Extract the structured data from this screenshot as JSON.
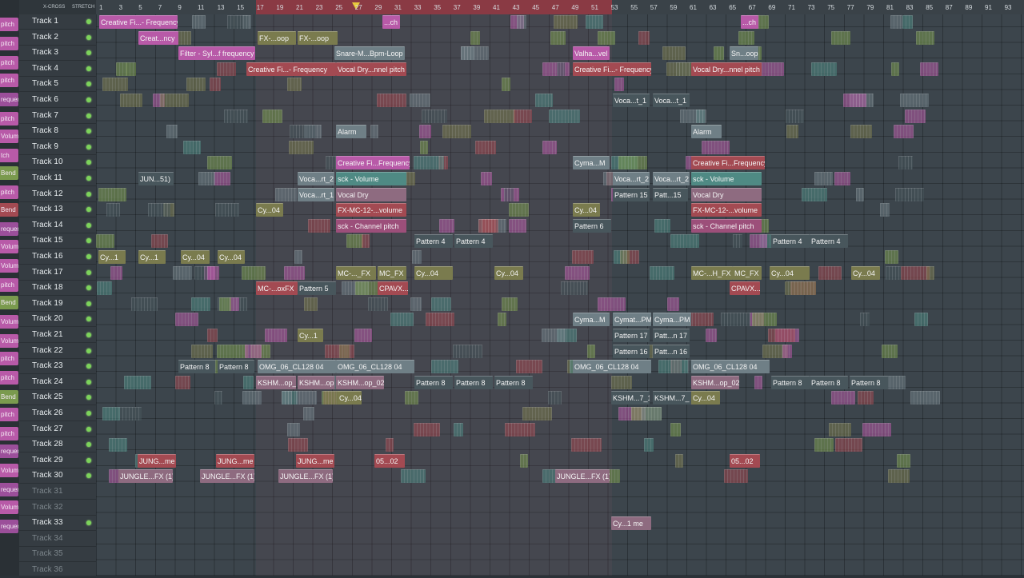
{
  "left_strip": [
    "pitch",
    "pitch",
    "pitch",
    "pitch",
    "requency",
    "pitch",
    "",
    "Volume",
    "tch",
    "Bend",
    "pitch",
    "Bend",
    "requency",
    "Volume",
    "Volume",
    "pitch",
    "Bend",
    "Volume",
    "Volume",
    "pitch",
    "pitch",
    "Bend",
    "pitch",
    "pitch",
    "requency",
    "Volume",
    "requency",
    "Volume",
    "requency"
  ],
  "top_controls": {
    "xcross": "X-CROSS",
    "stretch": "STRETCH"
  },
  "ruler_ticks": [
    "1",
    "3",
    "5",
    "7",
    "9",
    "11",
    "13",
    "15",
    "17",
    "19",
    "21",
    "23",
    "25",
    "27",
    "29",
    "31",
    "33",
    "35",
    "37",
    "39",
    "41",
    "43",
    "45",
    "47",
    "49",
    "51",
    "53",
    "55",
    "57",
    "59",
    "61",
    "63",
    "65",
    "67",
    "69",
    "71",
    "73",
    "75",
    "77",
    "79",
    "81",
    "83",
    "85",
    "87",
    "89",
    "91",
    "93"
  ],
  "tracks": [
    {
      "label": "Track 1",
      "active": true
    },
    {
      "label": "Track 2",
      "active": true
    },
    {
      "label": "Track 3",
      "active": true
    },
    {
      "label": "Track 4",
      "active": true
    },
    {
      "label": "Track 5",
      "active": true
    },
    {
      "label": "Track 6",
      "active": true
    },
    {
      "label": "Track 7",
      "active": true
    },
    {
      "label": "Track 8",
      "active": true
    },
    {
      "label": "Track 9",
      "active": true
    },
    {
      "label": "Track 10",
      "active": true
    },
    {
      "label": "Track 11",
      "active": true
    },
    {
      "label": "Track 12",
      "active": true
    },
    {
      "label": "Track 13",
      "active": true
    },
    {
      "label": "Track 14",
      "active": true
    },
    {
      "label": "Track 15",
      "active": true
    },
    {
      "label": "Track 16",
      "active": true
    },
    {
      "label": "Track 17",
      "active": true
    },
    {
      "label": "Track 18",
      "active": true
    },
    {
      "label": "Track 19",
      "active": true
    },
    {
      "label": "Track 20",
      "active": true
    },
    {
      "label": "Track 21",
      "active": true
    },
    {
      "label": "Track 22",
      "active": true
    },
    {
      "label": "Track 23",
      "active": true
    },
    {
      "label": "Track 24",
      "active": true
    },
    {
      "label": "Track 25",
      "active": true
    },
    {
      "label": "Track 26",
      "active": true
    },
    {
      "label": "Track 27",
      "active": true
    },
    {
      "label": "Track 28",
      "active": true
    },
    {
      "label": "Track 29",
      "active": true
    },
    {
      "label": "Track 30",
      "active": true
    },
    {
      "label": "Track 31",
      "active": false
    },
    {
      "label": "Track 32",
      "active": false
    },
    {
      "label": "Track 33",
      "active": true
    },
    {
      "label": "Track 34",
      "active": false
    },
    {
      "label": "Track 35",
      "active": false
    },
    {
      "label": "Track 36",
      "active": false
    }
  ],
  "clips": [
    {
      "t": 0,
      "label": "Creative Fi...- Frequency",
      "c": "c-pink"
    },
    {
      "t": 0,
      "label": "...ch",
      "c": "c-pink"
    },
    {
      "t": 0,
      "label": "...ch",
      "c": "c-pink"
    },
    {
      "t": 1,
      "label": "Creat...ncy",
      "c": "c-pink"
    },
    {
      "t": 1,
      "label": "FX-...oop",
      "c": "c-olive"
    },
    {
      "t": 1,
      "label": "FX-...oop",
      "c": "c-olive"
    },
    {
      "t": 2,
      "label": "Filter - Syl...f frequency",
      "c": "c-pink"
    },
    {
      "t": 2,
      "label": "Snare-M...Bpm-Loop",
      "c": "c-grey"
    },
    {
      "t": 2,
      "label": "Valha...vel",
      "c": "c-pink"
    },
    {
      "t": 2,
      "label": "Sn...oop",
      "c": "c-grey"
    },
    {
      "t": 3,
      "label": "Creative Fi...- Frequency",
      "c": "c-red"
    },
    {
      "t": 3,
      "label": "Vocal Dry...nnel pitch",
      "c": "c-red"
    },
    {
      "t": 3,
      "label": "Creative Fi...- Frequency",
      "c": "c-red"
    },
    {
      "t": 3,
      "label": "Vocal Dry...nnel pitch",
      "c": "c-red"
    },
    {
      "t": 5,
      "label": "Voca...t_1",
      "c": "c-dark"
    },
    {
      "t": 5,
      "label": "Voca...t_1",
      "c": "c-dark"
    },
    {
      "t": 7,
      "label": "Alarm",
      "c": "c-grey"
    },
    {
      "t": 7,
      "label": "Alarm",
      "c": "c-grey"
    },
    {
      "t": 9,
      "label": "Creative Fi...Frequency",
      "c": "c-pink"
    },
    {
      "t": 9,
      "label": "Cyma...M",
      "c": "c-grey"
    },
    {
      "t": 9,
      "label": "Creative Fi...Frequency",
      "c": "c-red"
    },
    {
      "t": 10,
      "label": "JUN...51)",
      "c": "c-dark"
    },
    {
      "t": 10,
      "label": "Voca...rt_2",
      "c": "c-grey"
    },
    {
      "t": 10,
      "label": "sck - Volume",
      "c": "c-teal"
    },
    {
      "t": 10,
      "label": "Voca...rt_2",
      "c": "c-grey"
    },
    {
      "t": 10,
      "label": "Voca...rt_2",
      "c": "c-grey"
    },
    {
      "t": 10,
      "label": "sck - Volume",
      "c": "c-teal"
    },
    {
      "t": 11,
      "label": "Voca...rt_1",
      "c": "c-grey"
    },
    {
      "t": 11,
      "label": "Vocal Dry",
      "c": "c-mauve"
    },
    {
      "t": 11,
      "label": "Pattern 15",
      "c": "c-dark"
    },
    {
      "t": 11,
      "label": "Patt...15",
      "c": "c-dark"
    },
    {
      "t": 11,
      "label": "Vocal Dry",
      "c": "c-mauve"
    },
    {
      "t": 12,
      "label": "Cy...04",
      "c": "c-olive"
    },
    {
      "t": 12,
      "label": "FX-MC-12-...volume",
      "c": "c-red"
    },
    {
      "t": 12,
      "label": "Cy...04",
      "c": "c-olive"
    },
    {
      "t": 12,
      "label": "FX-MC-12-...volume",
      "c": "c-red"
    },
    {
      "t": 13,
      "label": "sck - Channel pitch",
      "c": "c-rose"
    },
    {
      "t": 13,
      "label": "Pattern 6",
      "c": "c-dark"
    },
    {
      "t": 13,
      "label": "sck - Channel pitch",
      "c": "c-rose"
    },
    {
      "t": 14,
      "label": "Pattern 4",
      "c": "c-dark"
    },
    {
      "t": 14,
      "label": "Pattern 4",
      "c": "c-dark"
    },
    {
      "t": 14,
      "label": "Pattern 4",
      "c": "c-dark"
    },
    {
      "t": 14,
      "label": "Pattern 4",
      "c": "c-dark"
    },
    {
      "t": 15,
      "label": "Cy...1",
      "c": "c-olive"
    },
    {
      "t": 15,
      "label": "Cy...1",
      "c": "c-olive"
    },
    {
      "t": 15,
      "label": "Cy...04",
      "c": "c-olive"
    },
    {
      "t": 15,
      "label": "Cy...04",
      "c": "c-olive"
    },
    {
      "t": 16,
      "label": "MC-..._FX",
      "c": "c-olive"
    },
    {
      "t": 16,
      "label": "MC_FX",
      "c": "c-olive"
    },
    {
      "t": 16,
      "label": "Cy...04",
      "c": "c-olive"
    },
    {
      "t": 16,
      "label": "Cy...04",
      "c": "c-olive"
    },
    {
      "t": 16,
      "label": "MC-...H_FX",
      "c": "c-olive"
    },
    {
      "t": 16,
      "label": "MC_FX",
      "c": "c-olive"
    },
    {
      "t": 16,
      "label": "Cy...04",
      "c": "c-olive"
    },
    {
      "t": 16,
      "label": "Cy...04",
      "c": "c-olive"
    },
    {
      "t": 17,
      "label": "MC-...oxFX",
      "c": "c-red"
    },
    {
      "t": 17,
      "label": "Pattern 5",
      "c": "c-dark"
    },
    {
      "t": 17,
      "label": "CPAVX...",
      "c": "c-red"
    },
    {
      "t": 17,
      "label": "CPAVX...",
      "c": "c-red"
    },
    {
      "t": 19,
      "label": "Cyma...M",
      "c": "c-grey"
    },
    {
      "t": 19,
      "label": "Cymat...PM",
      "c": "c-grey"
    },
    {
      "t": 19,
      "label": "Cyma...PM",
      "c": "c-grey"
    },
    {
      "t": 20,
      "label": "Cy...1",
      "c": "c-olive"
    },
    {
      "t": 20,
      "label": "Pattern 17",
      "c": "c-dark"
    },
    {
      "t": 20,
      "label": "Patt...n 17",
      "c": "c-dark"
    },
    {
      "t": 21,
      "label": "Pattern 16",
      "c": "c-dark"
    },
    {
      "t": 21,
      "label": "Patt...n 16",
      "c": "c-dark"
    },
    {
      "t": 22,
      "label": "Pattern 8",
      "c": "c-dark"
    },
    {
      "t": 22,
      "label": "Pattern 8",
      "c": "c-dark"
    },
    {
      "t": 22,
      "label": "OMG_06_CL128 04",
      "c": "c-grey"
    },
    {
      "t": 22,
      "label": "OMG_06_CL128 04",
      "c": "c-grey"
    },
    {
      "t": 22,
      "label": "OMG_06_CL128 04",
      "c": "c-grey"
    },
    {
      "t": 22,
      "label": "OMG_06_CL128 04",
      "c": "c-grey"
    },
    {
      "t": 23,
      "label": "KSHM...op_",
      "c": "c-mauve"
    },
    {
      "t": 23,
      "label": "KSHM...op",
      "c": "c-mauve"
    },
    {
      "t": 23,
      "label": "KSHM...op_02",
      "c": "c-mauve"
    },
    {
      "t": 23,
      "label": "Pattern 8",
      "c": "c-dark"
    },
    {
      "t": 23,
      "label": "Pattern 8",
      "c": "c-dark"
    },
    {
      "t": 23,
      "label": "Pattern 8",
      "c": "c-dark"
    },
    {
      "t": 23,
      "label": "KSHM...op_02",
      "c": "c-mauve"
    },
    {
      "t": 23,
      "label": "Pattern 8",
      "c": "c-dark"
    },
    {
      "t": 23,
      "label": "Pattern 8",
      "c": "c-dark"
    },
    {
      "t": 23,
      "label": "Pattern 8",
      "c": "c-dark"
    },
    {
      "t": 24,
      "label": "Cy...04",
      "c": "c-olive"
    },
    {
      "t": 24,
      "label": "KSHM...7_1",
      "c": "c-dark"
    },
    {
      "t": 24,
      "label": "KSHM...7_",
      "c": "c-dark"
    },
    {
      "t": 24,
      "label": "Cy...04",
      "c": "c-olive"
    },
    {
      "t": 28,
      "label": "JUNG...me",
      "c": "c-red"
    },
    {
      "t": 28,
      "label": "JUNG...me",
      "c": "c-red"
    },
    {
      "t": 28,
      "label": "JUNG...me",
      "c": "c-red"
    },
    {
      "t": 28,
      "label": "05...02",
      "c": "c-red"
    },
    {
      "t": 28,
      "label": "05...02",
      "c": "c-red"
    },
    {
      "t": 29,
      "label": "JUNGLE...FX (1)",
      "c": "c-mauve"
    },
    {
      "t": 29,
      "label": "JUNGLE...FX (1)",
      "c": "c-mauve"
    },
    {
      "t": 29,
      "label": "JUNGLE...FX (1)",
      "c": "c-mauve"
    },
    {
      "t": 29,
      "label": "JUNGLE...FX (1)",
      "c": "c-mauve"
    },
    {
      "t": 32,
      "label": "Cy...1 me",
      "c": "c-mauve"
    }
  ]
}
